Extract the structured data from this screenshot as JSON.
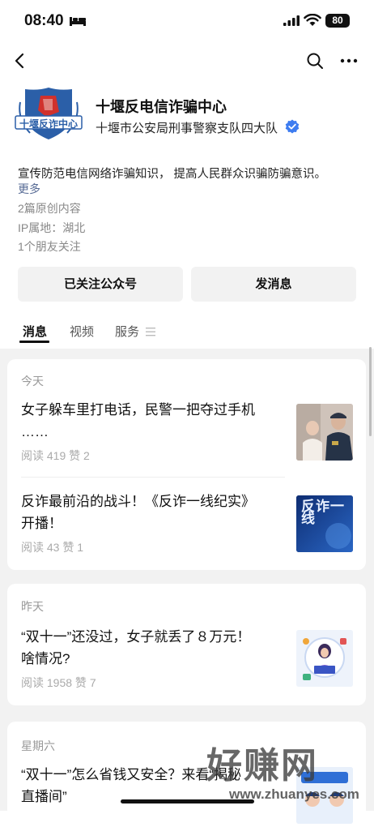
{
  "status_bar": {
    "time": "08:40",
    "battery": "80"
  },
  "account": {
    "name": "十堰反电信诈骗中心",
    "owner": "十堰市公安局刑事警察支队四大队",
    "logo_text": "十堰反诈中心",
    "description": "宣传防范电信网络诈骗知识， 提高人民群众识骗防骗意识。",
    "more": "更多",
    "original_count": "2篇原创内容",
    "ip_location": "IP属地：湖北",
    "friends_following": "1个朋友关注"
  },
  "actions": {
    "follow_label": "已关注公众号",
    "message_label": "发消息"
  },
  "tabs": {
    "messages": "消息",
    "videos": "视频",
    "services": "服务"
  },
  "feed": {
    "groups": [
      {
        "day": "今天",
        "articles": [
          {
            "title_line1": "女子躲车里打电话，民警一把夺过手机",
            "title_line2": "……",
            "stats": "阅读 419   赞 2",
            "thumb_icon": "police-photo"
          },
          {
            "title_line1": "反诈最前沿的战斗！《反诈一线纪实》",
            "title_line2": "开播！",
            "stats": "阅读 43   赞 1",
            "thumb_text": "反诈一线"
          }
        ]
      },
      {
        "day": "昨天",
        "articles": [
          {
            "title_line1": "“双十一”还没过，女子就丢了８万元！",
            "title_line2": "啥情况?",
            "stats": "阅读 1958   赞 7",
            "thumb_icon": "illustration-woman-laptop"
          }
        ]
      },
      {
        "day": "星期六",
        "articles": [
          {
            "title_line1": "“双十一”怎么省钱又安全？来看“揭秘",
            "title_line2": "直播间”",
            "thumb_icon": "police-cartoon"
          }
        ]
      }
    ]
  },
  "watermark": {
    "big": "好赚网",
    "url": "www.zhuanyes.com"
  },
  "colors": {
    "link": "#576b95",
    "verified": "#3d7cf0",
    "feed_bg": "#f2f2f2",
    "logo_blue": "#2b5fa8",
    "logo_red": "#d0312d"
  }
}
